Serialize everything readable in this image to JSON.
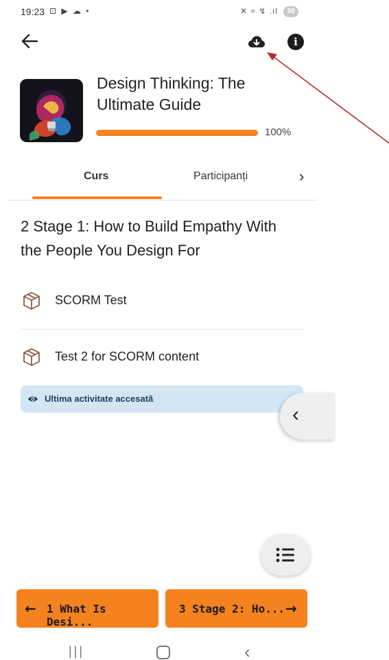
{
  "status_bar": {
    "time": "19:23",
    "left_icons": "⊡ ▶ ☁ •",
    "right_icons": "✕ ≈ ↯ .ıl",
    "battery": "30"
  },
  "app_bar": {
    "back_icon": "arrow-left-icon",
    "download_icon": "cloud-download-icon",
    "info_icon": "info-icon",
    "info_glyph": "i"
  },
  "course": {
    "title": "Design Thinking: The Ultimate Guide",
    "progress_label": "100%",
    "progress_fraction": 1.0
  },
  "tabs": {
    "items": [
      {
        "label": "Curs",
        "active": true
      },
      {
        "label": "Participanți",
        "active": false
      }
    ],
    "more_glyph": "›"
  },
  "section": {
    "title": "2 Stage 1: How to Build Empathy With the People You Design For"
  },
  "activities": [
    {
      "label": "SCORM Test",
      "icon": "package-icon"
    },
    {
      "label": "Test 2 for SCORM content",
      "icon": "package-icon"
    }
  ],
  "last_accessed": {
    "label": "Ultima activitate accesată",
    "icon": "eye-icon"
  },
  "drawer_toggle": {
    "glyph": "‹"
  },
  "nav_buttons": {
    "prev": {
      "arrow": "←",
      "label": "1 What Is Desi..."
    },
    "next": {
      "arrow": "→",
      "label": "3 Stage 2: Ho..."
    }
  },
  "system_nav": {
    "recent": "|||",
    "back": "‹"
  },
  "colors": {
    "accent": "#f4821f",
    "badge_bg": "#d4e6f4",
    "icon_brown": "#8a5a44",
    "annotation_arrow": "#b03030"
  }
}
